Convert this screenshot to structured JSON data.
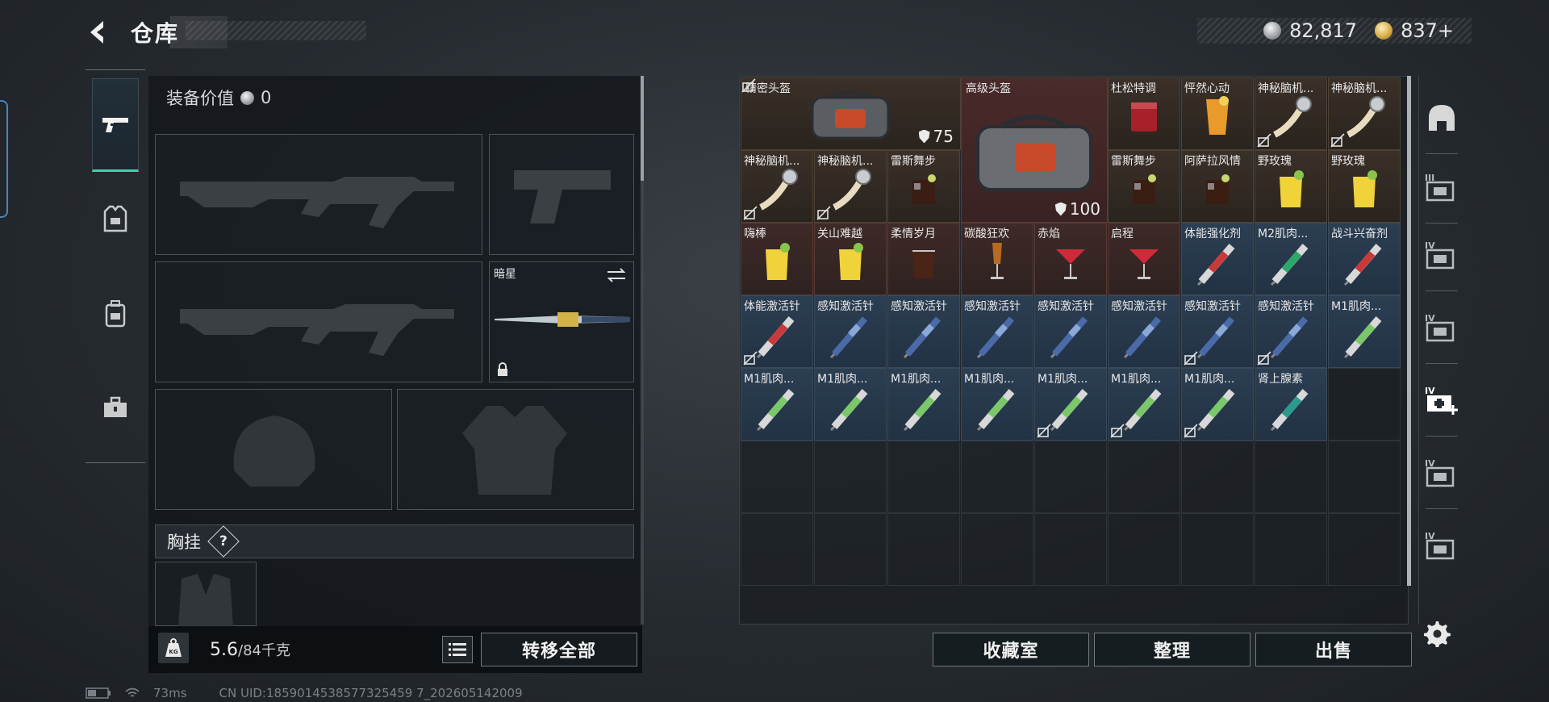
{
  "header": {
    "title": "仓库",
    "currency": [
      {
        "icon": "silver-coin-icon",
        "value": "82,817"
      },
      {
        "icon": "gold-coin-icon",
        "value": "837+"
      }
    ]
  },
  "loadout": {
    "equip_value_label": "装备价值",
    "equip_value": "0",
    "melee_slot_label": "暗星",
    "chest_rig_label": "胸挂",
    "help_glyph": "?",
    "weight_value": "5.6",
    "weight_limit": "/84千克",
    "transfer_all_label": "转移全部",
    "tabs": [
      "weapon-tab",
      "armor-tab",
      "backpack-tab",
      "kit-tab"
    ]
  },
  "storage": {
    "large_items": [
      {
        "name": "精密头盔",
        "durability": "75"
      },
      {
        "name": "高级头盔",
        "durability": "100"
      }
    ],
    "cells": [
      {
        "name": "杜松特调",
        "thumb": "cocktail-red",
        "locked": false
      },
      {
        "name": "怦然心动",
        "thumb": "cocktail-orange",
        "locked": false
      },
      {
        "name": "神秘脑机...",
        "thumb": "brain-chip",
        "locked": true
      },
      {
        "name": "神秘脑机...",
        "thumb": "brain-chip",
        "locked": true
      },
      {
        "name": "神秘脑机...",
        "thumb": "brain-chip",
        "locked": true
      },
      {
        "name": "神秘脑机...",
        "thumb": "brain-chip",
        "locked": true
      },
      {
        "name": "雷斯舞步",
        "thumb": "cocktail-cola",
        "locked": false
      },
      {
        "name": "雷斯舞步",
        "thumb": "cocktail-cola",
        "locked": false
      },
      {
        "name": "阿萨拉风情",
        "thumb": "cocktail-cola",
        "locked": false
      },
      {
        "name": "野玫瑰",
        "thumb": "cocktail-yellow",
        "locked": false
      },
      {
        "name": "野玫瑰",
        "thumb": "cocktail-yellow",
        "locked": false
      },
      {
        "name": "嗨棒",
        "thumb": "cocktail-yellow",
        "locked": false
      },
      {
        "name": "关山难越",
        "thumb": "cocktail-yellow",
        "locked": false
      },
      {
        "name": "柔情岁月",
        "thumb": "whisky-glass",
        "locked": false
      },
      {
        "name": "碳酸狂欢",
        "thumb": "champagne",
        "locked": false
      },
      {
        "name": "赤焰",
        "thumb": "martini",
        "locked": false
      },
      {
        "name": "启程",
        "thumb": "martini",
        "locked": false
      },
      {
        "name": "体能强化剂",
        "thumb": "syringe-red",
        "locked": false
      },
      {
        "name": "M2肌肉...",
        "thumb": "syringe-green",
        "locked": false
      },
      {
        "name": "战斗兴奋剂",
        "thumb": "syringe-red",
        "locked": false
      },
      {
        "name": "体能激活针",
        "thumb": "syringe-red",
        "locked": true
      },
      {
        "name": "感知激活针",
        "thumb": "syringe-blue",
        "locked": false
      },
      {
        "name": "感知激活针",
        "thumb": "syringe-blue",
        "locked": false
      },
      {
        "name": "感知激活针",
        "thumb": "syringe-blue",
        "locked": false
      },
      {
        "name": "感知激活针",
        "thumb": "syringe-blue",
        "locked": false
      },
      {
        "name": "感知激活针",
        "thumb": "syringe-blue",
        "locked": false
      },
      {
        "name": "感知激活针",
        "thumb": "syringe-blue",
        "locked": true
      },
      {
        "name": "感知激活针",
        "thumb": "syringe-blue",
        "locked": true
      },
      {
        "name": "M1肌肉...",
        "thumb": "syringe-lime",
        "locked": false
      },
      {
        "name": "M1肌肉...",
        "thumb": "syringe-lime",
        "locked": false
      },
      {
        "name": "M1肌肉...",
        "thumb": "syringe-lime",
        "locked": false
      },
      {
        "name": "M1肌肉...",
        "thumb": "syringe-lime",
        "locked": false
      },
      {
        "name": "M1肌肉...",
        "thumb": "syringe-lime",
        "locked": false
      },
      {
        "name": "M1肌肉...",
        "thumb": "syringe-lime",
        "locked": true
      },
      {
        "name": "M1肌肉...",
        "thumb": "syringe-lime",
        "locked": true
      },
      {
        "name": "M1肌肉...",
        "thumb": "syringe-lime",
        "locked": true
      },
      {
        "name": "肾上腺素",
        "thumb": "syringe-teal",
        "locked": false
      }
    ],
    "buttons": {
      "collection": "收藏室",
      "sort": "整理",
      "sell": "出售"
    },
    "categories": [
      {
        "icon": "safe-box-icon",
        "tier": ""
      },
      {
        "icon": "case-icon",
        "tier": "III"
      },
      {
        "icon": "case-icon",
        "tier": "IV"
      },
      {
        "icon": "case-icon",
        "tier": "IV"
      },
      {
        "icon": "medical-case-add-icon",
        "tier": "IV"
      },
      {
        "icon": "case-icon",
        "tier": "IV"
      },
      {
        "icon": "case-icon",
        "tier": "IV"
      }
    ]
  },
  "footer": {
    "ping": "73ms",
    "uid": "CN UID:1859014538577325459 7_202605142009"
  },
  "colors": {
    "accent_green": "#3fd2a8",
    "item_blue": "#2c3e52",
    "item_red": "#3e2a28"
  }
}
